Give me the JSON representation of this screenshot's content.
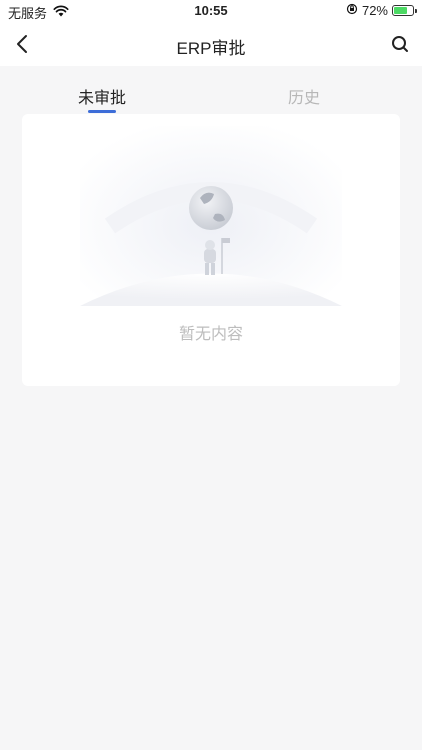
{
  "status_bar": {
    "carrier": "无服务",
    "time": "10:55",
    "battery": "72%",
    "icons": {
      "wifi": "wifi-icon",
      "orientation_lock": "orientation-lock-icon",
      "battery": "battery-icon",
      "charging": "charging-bolt-icon"
    }
  },
  "nav": {
    "title": "ERP审批",
    "back_icon": "back-chevron-icon",
    "search_icon": "search-icon"
  },
  "tabs": [
    {
      "label": "未审批",
      "active": true
    },
    {
      "label": "历史",
      "active": false
    }
  ],
  "empty_state": {
    "text": "暂无内容",
    "illustration": "astronaut-on-moon-illustration"
  },
  "colors": {
    "accent": "#3d6dd8",
    "inactive_text": "#b7b7b7",
    "background": "#f6f6f7",
    "battery_fill": "#4cd964"
  },
  "battery_level": 0.72
}
